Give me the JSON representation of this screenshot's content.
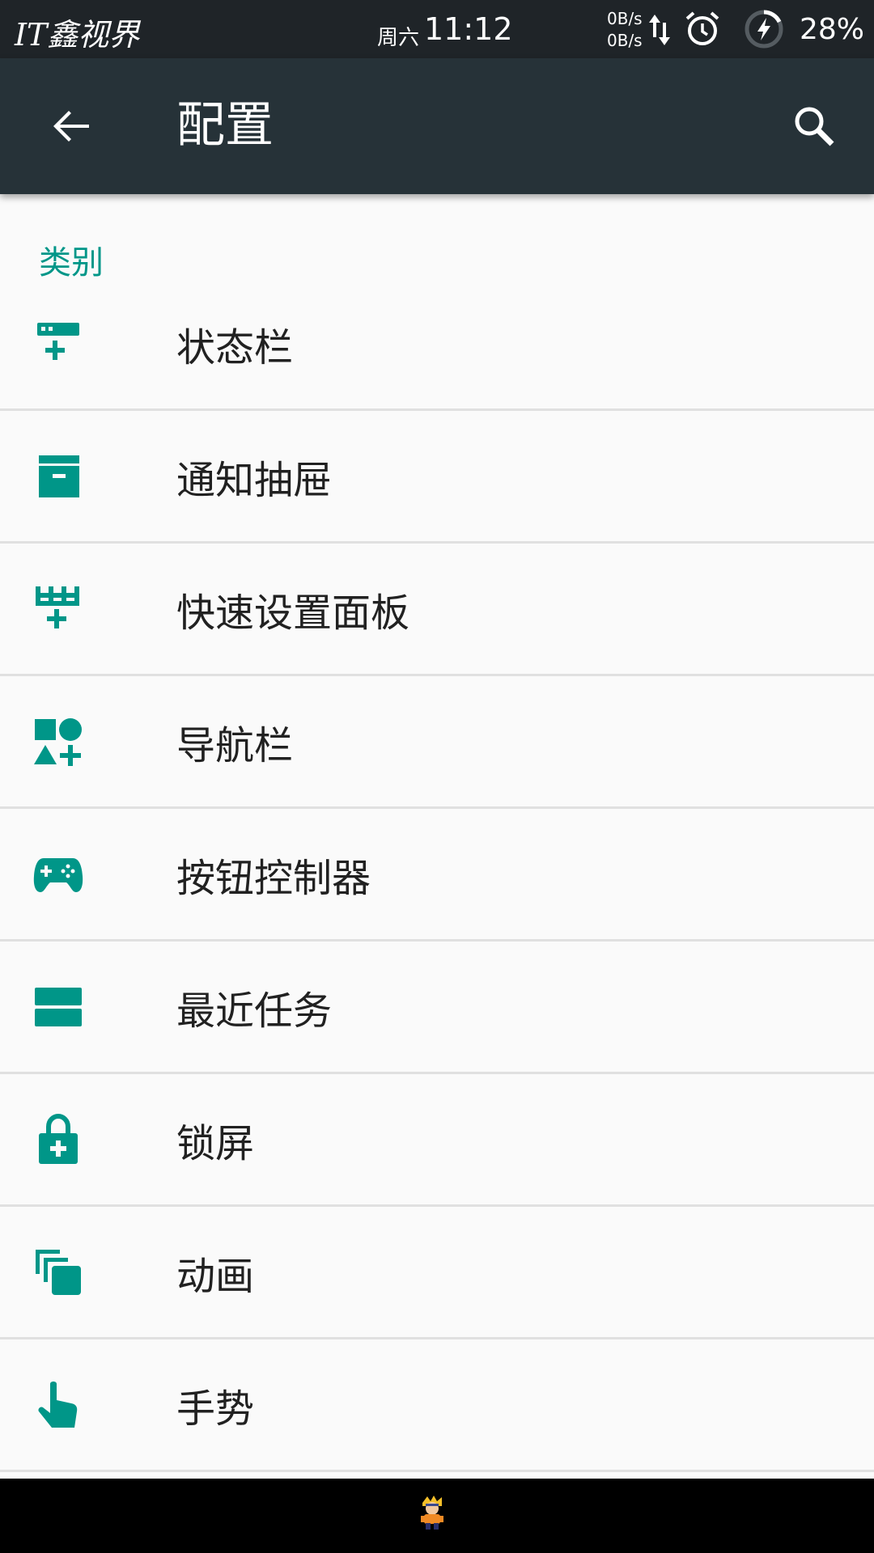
{
  "status_bar": {
    "brand": "IT鑫视界",
    "day": "周六",
    "time": "11:12",
    "net_up": "0B/s",
    "net_down": "0B/s",
    "battery_percent": "28%",
    "icons": [
      "data-arrows-icon",
      "alarm-icon",
      "battery-charging-icon"
    ]
  },
  "app_bar": {
    "title": "配置",
    "back_icon": "arrow-back-icon",
    "search_icon": "search-icon"
  },
  "section": {
    "header": "类别"
  },
  "items": [
    {
      "label": "状态栏",
      "icon": "status-bar-add-icon"
    },
    {
      "label": "通知抽屉",
      "icon": "archive-box-icon"
    },
    {
      "label": "快速设置面板",
      "icon": "quick-settings-grid-icon"
    },
    {
      "label": "导航栏",
      "icon": "shapes-icon"
    },
    {
      "label": "按钮控制器",
      "icon": "gamepad-icon"
    },
    {
      "label": "最近任务",
      "icon": "recents-stack-icon"
    },
    {
      "label": "锁屏",
      "icon": "lock-add-icon"
    },
    {
      "label": "动画",
      "icon": "layers-icon"
    },
    {
      "label": "手势",
      "icon": "hand-pointer-icon"
    }
  ],
  "colors": {
    "accent": "#009688",
    "app_bar": "#263238",
    "status_bar": "#1f2428",
    "background": "#fafafa",
    "divider": "#e0e0e0"
  }
}
